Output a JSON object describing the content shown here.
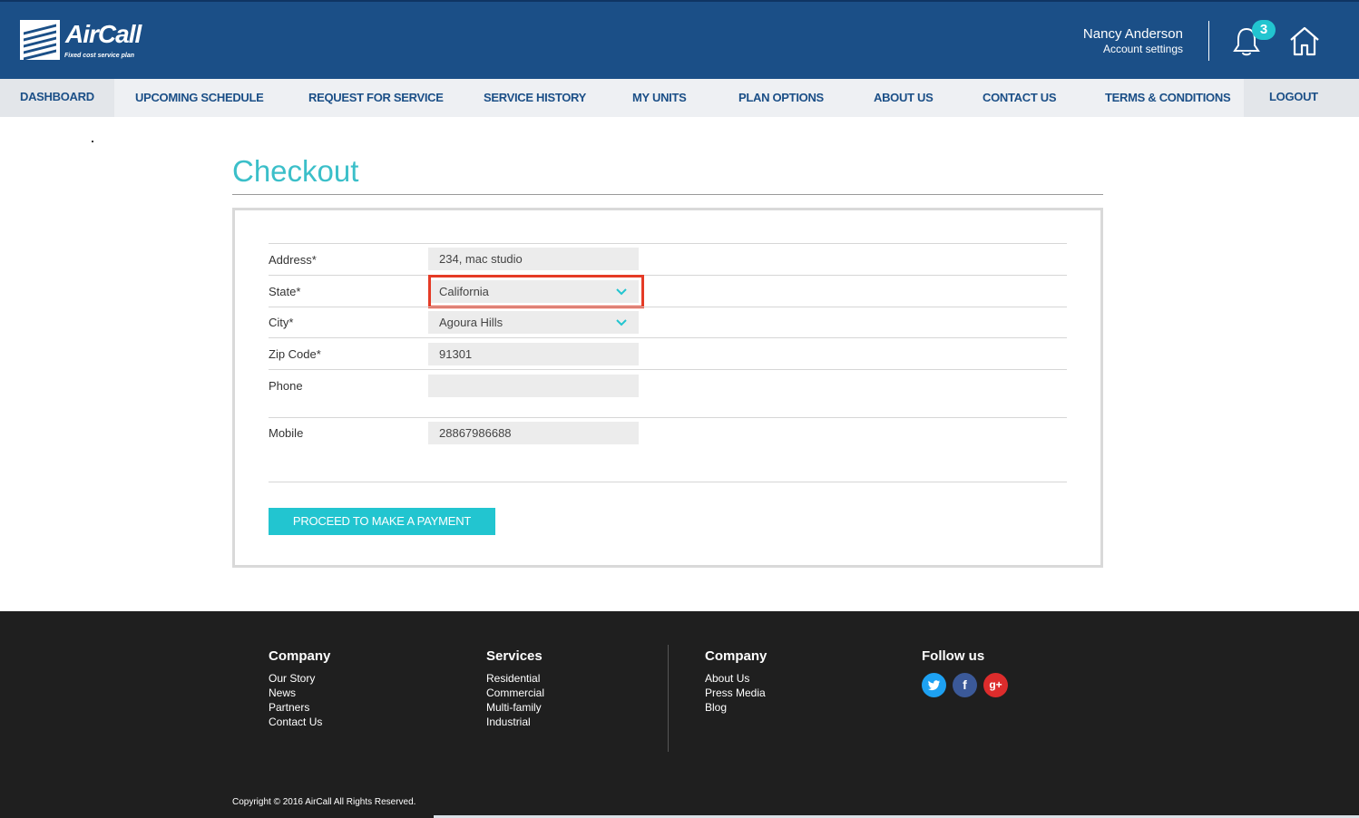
{
  "header": {
    "logo_text": "AirCall",
    "logo_tagline": "Fixed cost service plan",
    "user_name": "Nancy Anderson",
    "account_settings": "Account settings",
    "notification_count": "3",
    "brand_color": "#1b4f87",
    "accent_color": "#22c5d0"
  },
  "nav": {
    "items": [
      {
        "label": "DASHBOARD"
      },
      {
        "label": "UPCOMING SCHEDULE"
      },
      {
        "label": "REQUEST FOR SERVICE"
      },
      {
        "label": "SERVICE HISTORY"
      },
      {
        "label": "MY UNITS"
      },
      {
        "label": "PLAN OPTIONS"
      },
      {
        "label": "ABOUT US"
      },
      {
        "label": "CONTACT US"
      },
      {
        "label": "TERMS & CONDITIONS"
      },
      {
        "label": "LOGOUT"
      }
    ]
  },
  "page": {
    "title": "Checkout"
  },
  "form": {
    "address_label": "Address*",
    "address_value": "234, mac studio",
    "state_label": "State*",
    "state_value": "California",
    "city_label": "City*",
    "city_value": "Agoura Hills",
    "zip_label": "Zip Code*",
    "zip_value": "91301",
    "phone_label": "Phone",
    "phone_value": "",
    "mobile_label": "Mobile",
    "mobile_value": "28867986688",
    "submit_label": "PROCEED TO MAKE A PAYMENT",
    "highlight_color": "#e53b26"
  },
  "footer": {
    "col1": {
      "heading": "Company",
      "links": [
        "Our Story",
        "News",
        "Partners",
        "Contact Us"
      ]
    },
    "col2": {
      "heading": "Services",
      "links": [
        "Residential",
        "Commercial",
        "Multi-family",
        "Industrial"
      ]
    },
    "col3": {
      "heading": "Company",
      "links": [
        "About Us",
        "Press Media",
        "Blog"
      ]
    },
    "col4": {
      "heading": "Follow us",
      "social": [
        "twitter-icon",
        "facebook-icon",
        "google-plus-icon"
      ],
      "facebook_glyph": "f",
      "google_glyph": "g+"
    },
    "copyright": "Copyright © 2016 AirCall All Rights Reserved."
  }
}
